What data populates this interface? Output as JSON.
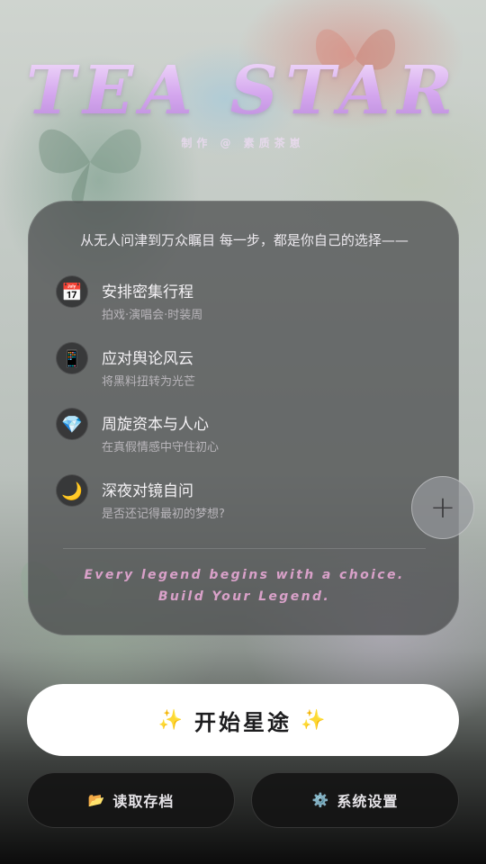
{
  "header": {
    "title": "TEA STAR",
    "subtitle": "制作 @ 素质茶崽"
  },
  "card": {
    "intro": "从无人问津到万众瞩目 每一步，都是你自己的选择——",
    "features": [
      {
        "icon": "calendar-icon",
        "glyph": "📅",
        "title": "安排密集行程",
        "subtitle": "拍戏·演唱会·时装周"
      },
      {
        "icon": "phone-icon",
        "glyph": "📱",
        "title": "应对舆论风云",
        "subtitle": "将黑料扭转为光芒"
      },
      {
        "icon": "gem-icon",
        "glyph": "💎",
        "title": "周旋资本与人心",
        "subtitle": "在真假情感中守住初心"
      },
      {
        "icon": "moon-icon",
        "glyph": "🌙",
        "title": "深夜对镜自问",
        "subtitle": "是否还记得最初的梦想?"
      }
    ],
    "quote_line1": "Every legend begins with a choice.",
    "quote_line2": "Build Your Legend."
  },
  "floating": {
    "plus_label": "+"
  },
  "actions": {
    "start_label": "开始星途",
    "start_spark": "✨",
    "load_icon": "📂",
    "load_label": "读取存档",
    "settings_icon": "⚙️",
    "settings_label": "系统设置"
  },
  "colors": {
    "title_gradient_top": "#f4e2fb",
    "title_gradient_bottom": "#b98ad9",
    "quote": "#d9a1c9",
    "card_bg": "rgba(70,72,74,0.72)",
    "start_bg": "#ffffff"
  }
}
